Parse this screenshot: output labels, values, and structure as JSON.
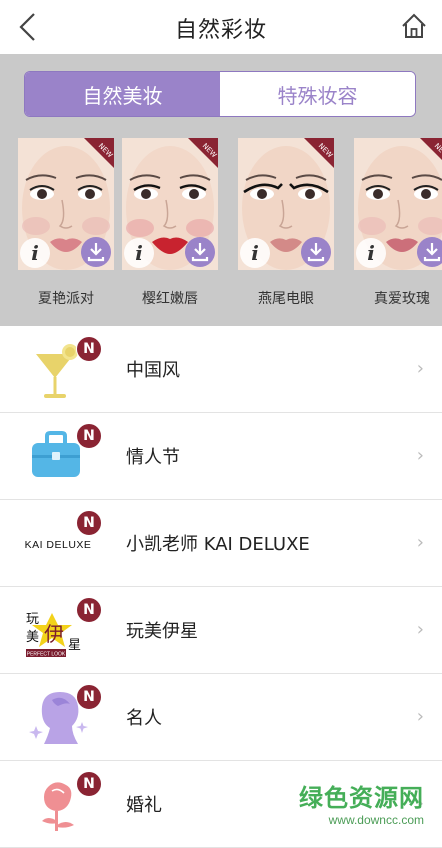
{
  "header": {
    "title": "自然彩妆"
  },
  "segments": [
    {
      "label": "自然美妆",
      "active": true
    },
    {
      "label": "特殊妆容",
      "active": false
    }
  ],
  "looks": [
    {
      "name": "夏艳派对",
      "lip": "#d9838a"
    },
    {
      "name": "樱红嫩唇",
      "lip": "#c8232f"
    },
    {
      "name": "燕尾电眼",
      "lip": "#d38a88"
    },
    {
      "name": "真爱玫瑰",
      "lip": "#cc6f7a"
    }
  ],
  "new_badge": "NEW",
  "info_glyph": "i",
  "list_badge": "N",
  "chevron": "›",
  "list_items": [
    {
      "label": "中国风",
      "icon": "cocktail-icon"
    },
    {
      "label": "情人节",
      "icon": "briefcase-icon"
    },
    {
      "label": "小凯老师 KAI DELUXE",
      "icon": "kai-deluxe-logo",
      "logo_text": "KAI DELUXE"
    },
    {
      "label": "玩美伊星",
      "icon": "perfect-look-logo",
      "logo_text": "玩美伊星",
      "logo_sub": "PERFECT LOOK"
    },
    {
      "label": "名人",
      "icon": "celebrity-silhouette-icon"
    },
    {
      "label": "婚礼",
      "icon": "rose-icon"
    }
  ],
  "watermark": {
    "main": "绿色资源网",
    "sub": "www.downcc.com"
  },
  "colors": {
    "accent": "#9a83c9",
    "badge": "#8a2433",
    "watermark": "#36a84a"
  }
}
